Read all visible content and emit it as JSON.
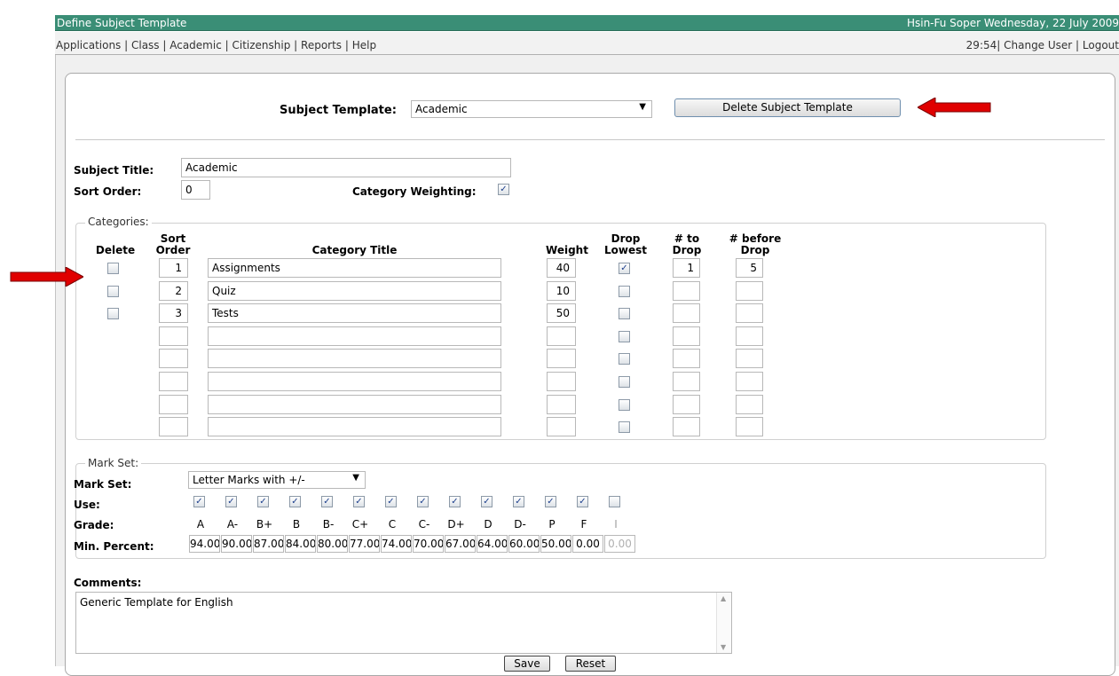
{
  "window": {
    "title": "Define Subject Template",
    "user_info": "Hsin-Fu Soper  Wednesday, 22 July 2009"
  },
  "menu": {
    "items": [
      "Applications",
      "Class",
      "Academic",
      "Citizenship",
      "Reports",
      "Help"
    ],
    "timer": "29:54|",
    "change_user": "Change User",
    "logout": "Logout"
  },
  "template_selector": {
    "label": "Subject Template:",
    "value": "Academic",
    "delete_button": "Delete Subject Template"
  },
  "subject": {
    "title_label": "Subject Title:",
    "title_value": "Academic",
    "sort_label": "Sort Order:",
    "sort_value": "0",
    "weighting_label": "Category Weighting:",
    "weighting_checked": true
  },
  "categories": {
    "legend": "Categories:",
    "headers": {
      "delete": "Delete",
      "sort_order": [
        "Sort",
        "Order"
      ],
      "title": "Category Title",
      "weight": "Weight",
      "drop_lowest": [
        "Drop",
        "Lowest"
      ],
      "to_drop": [
        "# to",
        "Drop"
      ],
      "before_drop": [
        "# before",
        "Drop"
      ]
    },
    "rows": [
      {
        "sort": "1",
        "title": "Assignments",
        "weight": "40",
        "drop_lowest": true,
        "to_drop": "1",
        "before_drop": "5",
        "has_delete": true
      },
      {
        "sort": "2",
        "title": "Quiz",
        "weight": "10",
        "drop_lowest": false,
        "to_drop": "",
        "before_drop": "",
        "has_delete": true
      },
      {
        "sort": "3",
        "title": "Tests",
        "weight": "50",
        "drop_lowest": false,
        "to_drop": "",
        "before_drop": "",
        "has_delete": true
      },
      {
        "sort": "",
        "title": "",
        "weight": "",
        "drop_lowest": false,
        "to_drop": "",
        "before_drop": "",
        "has_delete": false
      },
      {
        "sort": "",
        "title": "",
        "weight": "",
        "drop_lowest": false,
        "to_drop": "",
        "before_drop": "",
        "has_delete": false
      },
      {
        "sort": "",
        "title": "",
        "weight": "",
        "drop_lowest": false,
        "to_drop": "",
        "before_drop": "",
        "has_delete": false
      },
      {
        "sort": "",
        "title": "",
        "weight": "",
        "drop_lowest": false,
        "to_drop": "",
        "before_drop": "",
        "has_delete": false
      },
      {
        "sort": "",
        "title": "",
        "weight": "",
        "drop_lowest": false,
        "to_drop": "",
        "before_drop": "",
        "has_delete": false
      }
    ]
  },
  "mark_set": {
    "legend": "Mark Set:",
    "mark_set_label": "Mark Set:",
    "mark_set_value": "Letter Marks with +/-",
    "use_label": "Use:",
    "grade_label": "Grade:",
    "min_percent_label": "Min. Percent:",
    "grades": [
      {
        "grade": "A",
        "use": true,
        "min": "94.00"
      },
      {
        "grade": "A-",
        "use": true,
        "min": "90.00"
      },
      {
        "grade": "B+",
        "use": true,
        "min": "87.00"
      },
      {
        "grade": "B",
        "use": true,
        "min": "84.00"
      },
      {
        "grade": "B-",
        "use": true,
        "min": "80.00"
      },
      {
        "grade": "C+",
        "use": true,
        "min": "77.00"
      },
      {
        "grade": "C",
        "use": true,
        "min": "74.00"
      },
      {
        "grade": "C-",
        "use": true,
        "min": "70.00"
      },
      {
        "grade": "D+",
        "use": true,
        "min": "67.00"
      },
      {
        "grade": "D",
        "use": true,
        "min": "64.00"
      },
      {
        "grade": "D-",
        "use": true,
        "min": "60.00"
      },
      {
        "grade": "P",
        "use": true,
        "min": "50.00"
      },
      {
        "grade": "F",
        "use": true,
        "min": "0.00"
      },
      {
        "grade": "I",
        "use": false,
        "min": "0.00"
      }
    ]
  },
  "comments": {
    "label": "Comments:",
    "value": "Generic Template for English"
  },
  "actions": {
    "save": "Save",
    "reset": "Reset"
  },
  "colors": {
    "titlebar": "#3a8e76",
    "arrow": "#e00000",
    "check": "#1d3f8c"
  }
}
